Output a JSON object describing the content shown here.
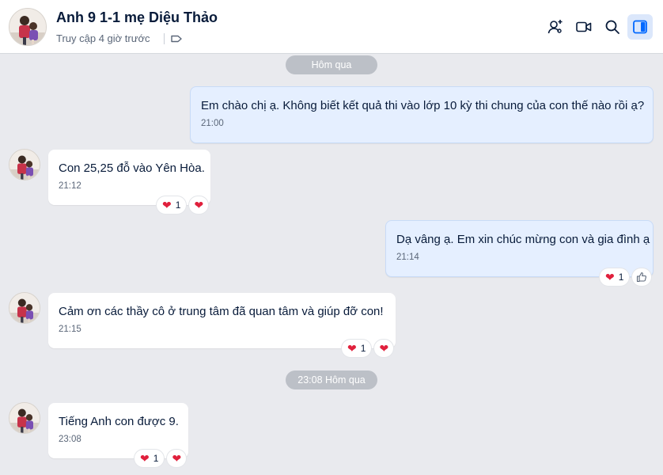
{
  "header": {
    "title": "Anh 9 1-1 mẹ Diệu Thảo",
    "status": "Truy cập 4 giờ trước",
    "buttons": [
      {
        "icon": "add-user-icon"
      },
      {
        "icon": "video-call-icon"
      },
      {
        "icon": "search-icon"
      },
      {
        "icon": "sidebar-toggle-icon",
        "active": true
      }
    ]
  },
  "dividers": {
    "first": "Hôm qua",
    "second": "23:08 Hôm qua"
  },
  "messages": [
    {
      "side": "out",
      "text": "Em chào chị ạ. Không biết kết quả thi vào lớp 10 kỳ thi chung của con thế nào rồi ạ?",
      "time": "21:00"
    },
    {
      "side": "in",
      "text": "Con 25,25 đỗ vào Yên Hòa.",
      "time": "21:12",
      "reaction_count": "1"
    },
    {
      "side": "out",
      "text": "Dạ vâng ạ. Em xin chúc mừng con và gia đình ạ",
      "time": "21:14",
      "reaction_count": "1"
    },
    {
      "side": "in",
      "text": "Cảm ơn các thầy cô ở trung tâm đã quan tâm và giúp đỡ con!",
      "time": "21:15",
      "reaction_count": "1"
    },
    {
      "side": "in",
      "text": "Tiếng Anh con được 9.",
      "time": "23:08",
      "reaction_count": "1"
    }
  ],
  "colors": {
    "accent": "#0068ff",
    "heart": "#e0203c",
    "outgoing_bubble": "#e5efff"
  }
}
